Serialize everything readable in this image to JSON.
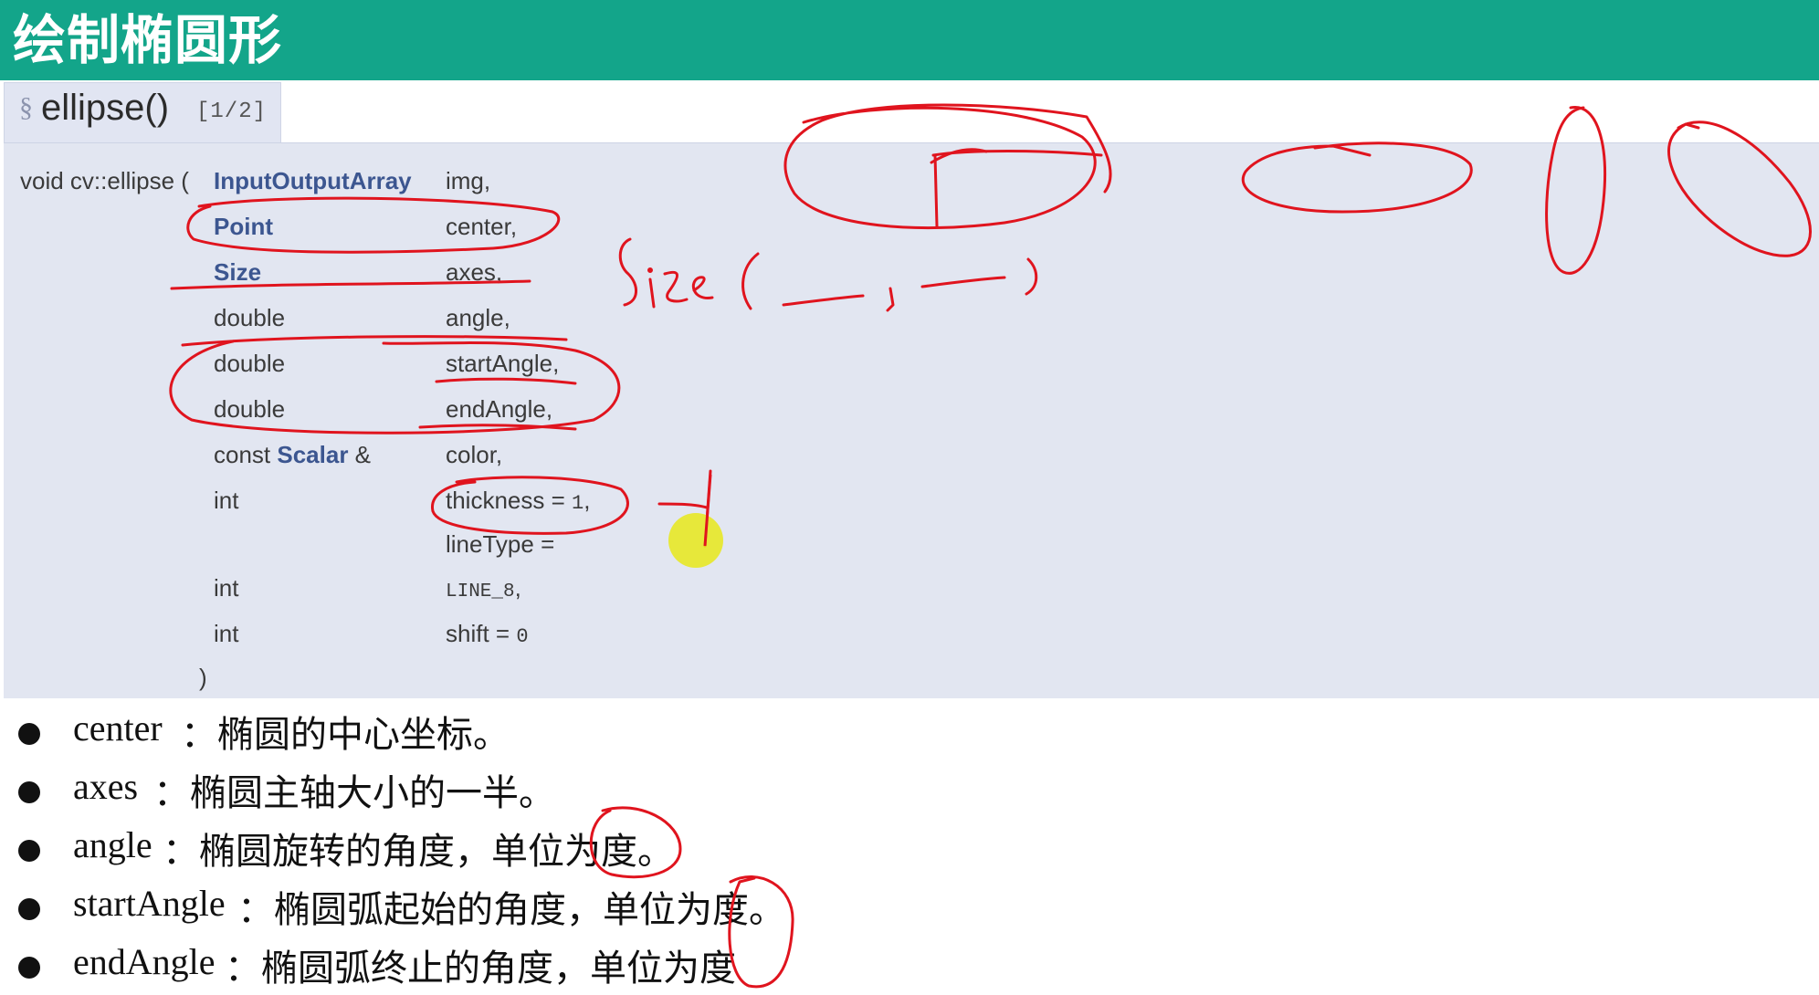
{
  "header": {
    "title": "绘制椭圆形"
  },
  "function_tab": {
    "section_mark": "§",
    "name": "ellipse()",
    "pages": "[1/2]"
  },
  "signature": {
    "prefix": "void cv::ellipse (",
    "params": [
      {
        "type": "InputOutputArray",
        "name": "img,",
        "type_is_class": true
      },
      {
        "type": "Point",
        "name": "center,",
        "type_is_class": true
      },
      {
        "type": "Size",
        "name": "axes,",
        "type_is_class": true
      },
      {
        "type": "double",
        "name": "angle,",
        "type_is_class": false
      },
      {
        "type": "double",
        "name": "startAngle,",
        "type_is_class": false
      },
      {
        "type": "double",
        "name": "endAngle,",
        "type_is_class": false
      },
      {
        "type_prefix": "const ",
        "type": "Scalar",
        "type_suffix": " &",
        "name": "color,",
        "type_is_class": true
      },
      {
        "type": "int",
        "name_pre": "thickness = ",
        "name_code": "1",
        "name_post": ",",
        "type_is_class": false
      },
      {
        "type": "",
        "name": "lineType =",
        "type_is_class": false
      },
      {
        "type": "int",
        "name_code": "LINE_8",
        "name_post": ",",
        "type_is_class": false
      },
      {
        "type": "int",
        "name_pre": "shift = ",
        "name_code": "0",
        "type_is_class": false
      }
    ],
    "close": ")"
  },
  "bullets": [
    {
      "term": "center",
      "desc": "：椭圆的中心坐标。"
    },
    {
      "term": "axes",
      "desc": "：椭圆主轴大小的一半。"
    },
    {
      "term": "angle",
      "desc": "：椭圆旋转的角度，单位为度。"
    },
    {
      "term": "startAngle",
      "desc": "：椭圆弧起始的角度，单位为度。"
    },
    {
      "term": "endAngle",
      "desc": "：椭圆弧终止的角度，单位为度"
    }
  ],
  "colors": {
    "header_bg": "#13a58a",
    "prototype_bg": "#e2e6f1",
    "class_type": "#3c5690",
    "annotation": "#e0141e",
    "pointer": "#e8e81a"
  }
}
